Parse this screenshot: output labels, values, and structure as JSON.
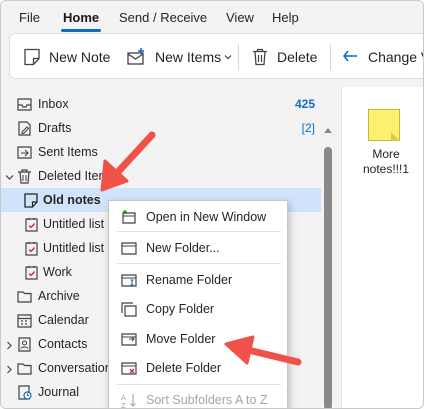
{
  "menubar": {
    "tabs": [
      {
        "label": "File"
      },
      {
        "label": "Home",
        "active": true
      },
      {
        "label": "Send / Receive"
      },
      {
        "label": "View"
      },
      {
        "label": "Help"
      }
    ]
  },
  "ribbon": {
    "new_note": "New Note",
    "new_items": "New Items",
    "delete": "Delete",
    "change_view": "Change V"
  },
  "folders": {
    "inbox": {
      "label": "Inbox",
      "count": "425"
    },
    "drafts": {
      "label": "Drafts",
      "count": "[2]"
    },
    "sent": {
      "label": "Sent Items"
    },
    "deleted": {
      "label": "Deleted Items"
    },
    "old_notes": {
      "label": "Old notes"
    },
    "untitled_1": {
      "label": "Untitled list"
    },
    "untitled_2": {
      "label": "Untitled list"
    },
    "work": {
      "label": "Work"
    },
    "archive": {
      "label": "Archive"
    },
    "calendar": {
      "label": "Calendar"
    },
    "contacts": {
      "label": "Contacts"
    },
    "conversation": {
      "label": "Conversation"
    },
    "journal": {
      "label": "Journal"
    }
  },
  "notes_list": {
    "item_label": "More notes!!!1"
  },
  "context_menu": {
    "open_new_window": "Open in New Window",
    "new_folder": "New Folder...",
    "rename_folder": "Rename Folder",
    "copy_folder": "Copy Folder",
    "move_folder": "Move Folder",
    "delete_folder": "Delete Folder",
    "sort_subfolders": "Sort Subfolders A to Z"
  },
  "colors": {
    "accent": "#0f6cbd",
    "selection": "#cfe4fa",
    "annotation_arrow": "#f0524a",
    "note_yellow": "#fbf070"
  }
}
